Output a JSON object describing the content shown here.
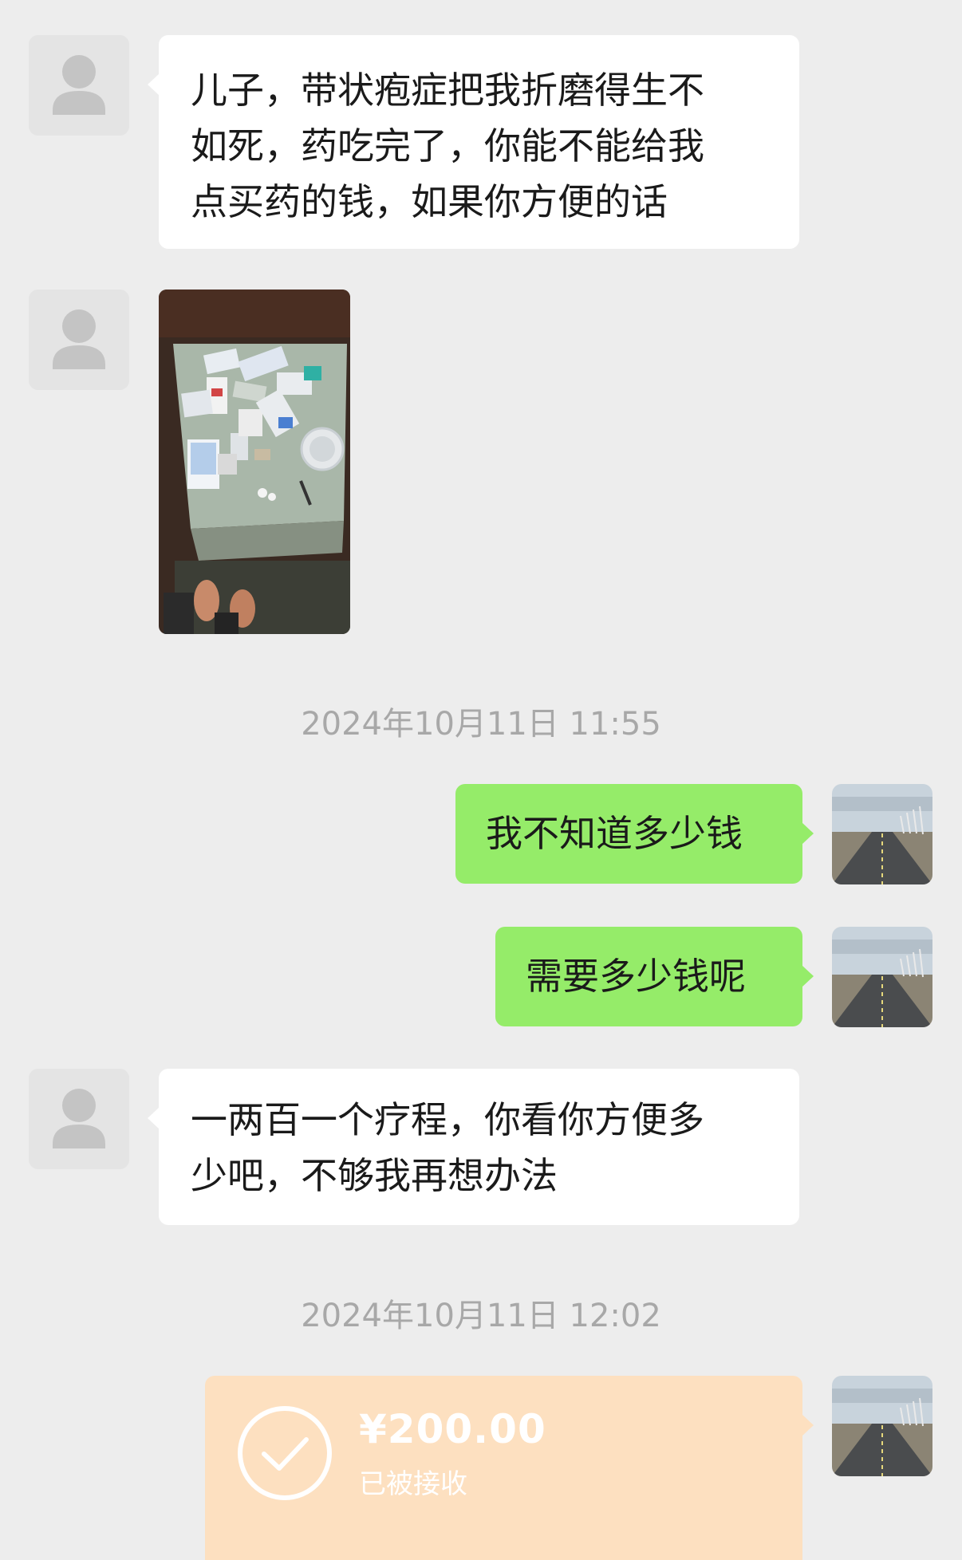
{
  "messages": {
    "m1": {
      "lines": [
        "儿子，带状疱症把我折磨得生不",
        "如死，药吃完了，你能不能给我",
        "点买药的钱，如果你方便的话"
      ]
    },
    "m3_time": "2024年10月11日 11:55",
    "m4": "我不知道多少钱",
    "m5": "需要多少钱呢",
    "m6": {
      "lines": [
        "一两百一个疗程，你看你方便多",
        "少吧，不够我再想办法"
      ]
    },
    "m7_time": "2024年10月11日 12:02",
    "transfer": {
      "amount": "¥200.00",
      "status": "已被接收"
    }
  },
  "icons": {
    "incoming_avatar": "default-user-avatar",
    "outgoing_avatar": "road-landscape-avatar",
    "transfer_icon": "check-circle-icon"
  },
  "colors": {
    "background": "#ededed",
    "incoming_bubble": "#ffffff",
    "outgoing_bubble": "#95ec69",
    "transfer_bubble": "#fde0c0",
    "timestamp_text": "#a8a8a8"
  }
}
